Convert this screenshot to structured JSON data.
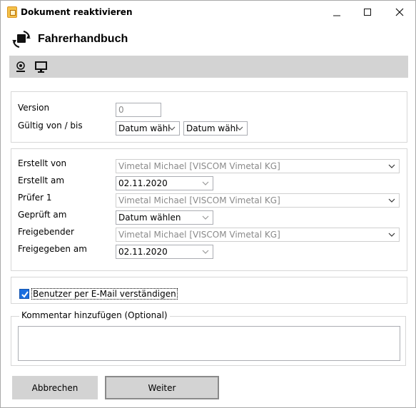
{
  "window": {
    "title": "Dokument reaktivieren",
    "controls": {
      "minimize": "—",
      "close": "✕"
    }
  },
  "header": {
    "document_name": "Fahrerhandbuch"
  },
  "toolbar": {
    "items": [
      "settings-icon",
      "monitor-icon"
    ]
  },
  "version_group": {
    "version_label": "Version",
    "version_value": "0",
    "valid_label": "Gültig von / bis",
    "valid_from": "Datum wähl",
    "valid_to": "Datum wähl"
  },
  "meta_group": {
    "created_by_label": "Erstellt von",
    "created_by_value": "Vimetal Michael [VISCOM Vimetal KG]",
    "created_on_label": "Erstellt am",
    "created_on_value": "02.11.2020",
    "reviewer_label": "Prüfer 1",
    "reviewer_value": "Vimetal Michael [VISCOM Vimetal KG]",
    "reviewed_on_label": "Geprüft am",
    "reviewed_on_value": "Datum wählen",
    "approver_label": "Freigebender",
    "approver_value": "Vimetal Michael [VISCOM Vimetal KG]",
    "approved_on_label": "Freigegeben am",
    "approved_on_value": "02.11.2020"
  },
  "notify": {
    "label": "Benutzer per E-Mail verständigen",
    "checked": true
  },
  "comment": {
    "legend": "Kommentar hinzufügen (Optional)",
    "value": ""
  },
  "buttons": {
    "cancel": "Abbrechen",
    "next": "Weiter"
  },
  "colors": {
    "toolbar_bg": "#d3d3d3",
    "checkbox": "#1b6fe0",
    "button_bg": "#d3d3d3"
  }
}
